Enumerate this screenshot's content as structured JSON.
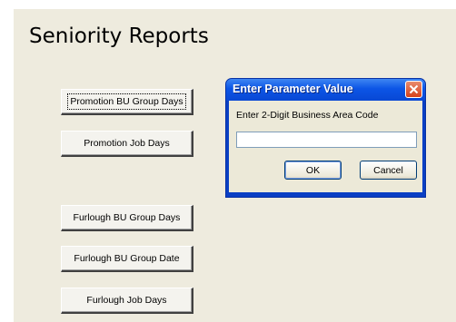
{
  "form": {
    "title": "Seniority Reports",
    "buttons": [
      {
        "label": "Promotion BU Group Days"
      },
      {
        "label": "Promotion Job Days"
      },
      {
        "label": "Furlough BU Group Days"
      },
      {
        "label": "Furlough BU Group Date"
      },
      {
        "label": "Furlough Job Days"
      }
    ]
  },
  "dialog": {
    "title": "Enter Parameter Value",
    "prompt": "Enter 2-Digit Business Area Code",
    "input_value": "",
    "ok_label": "OK",
    "cancel_label": "Cancel",
    "close_icon": "close-x-icon"
  },
  "colors": {
    "form_background": "#eeebde",
    "titlebar_blue": "#0c55e6",
    "close_red": "#d5421b"
  }
}
